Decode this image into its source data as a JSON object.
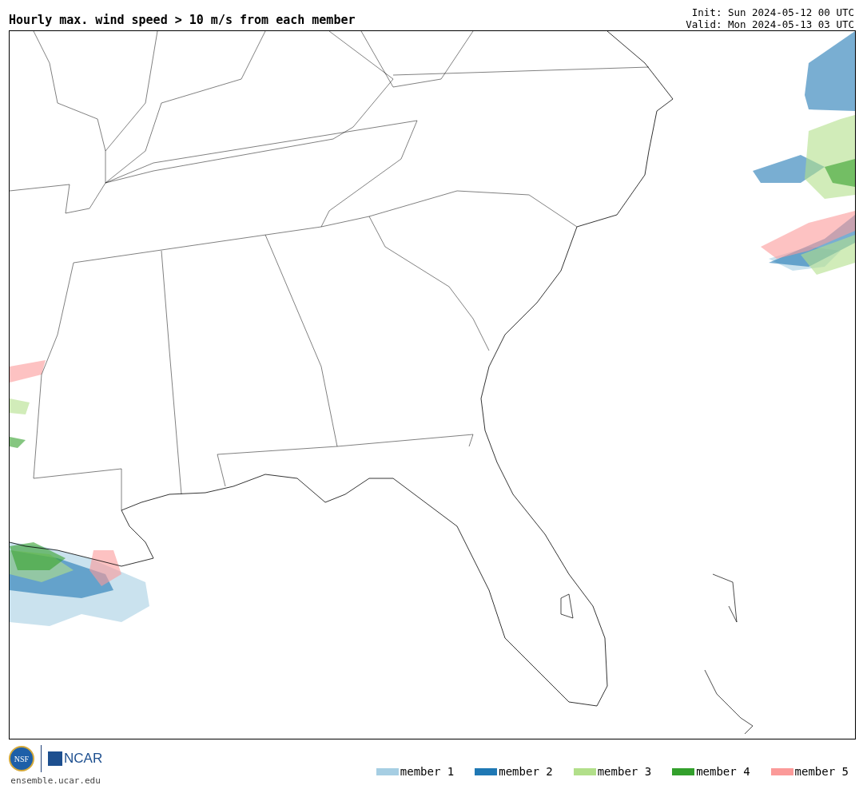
{
  "title": "Hourly max. wind speed > 10 m/s from each member",
  "init": "Init: Sun 2024-05-12 00 UTC",
  "valid": "Valid: Mon 2024-05-13 03 UTC",
  "footer": {
    "nsf_logo": "NSF",
    "ncar_logo": "NCAR",
    "url": "ensemble.ucar.edu"
  },
  "legend": [
    {
      "label": "member 1",
      "color": "#a6cee3"
    },
    {
      "label": "member 2",
      "color": "#1f78b4"
    },
    {
      "label": "member 3",
      "color": "#b2df8a"
    },
    {
      "label": "member 4",
      "color": "#33a02c"
    },
    {
      "label": "member 5",
      "color": "#fb9a99"
    }
  ]
}
